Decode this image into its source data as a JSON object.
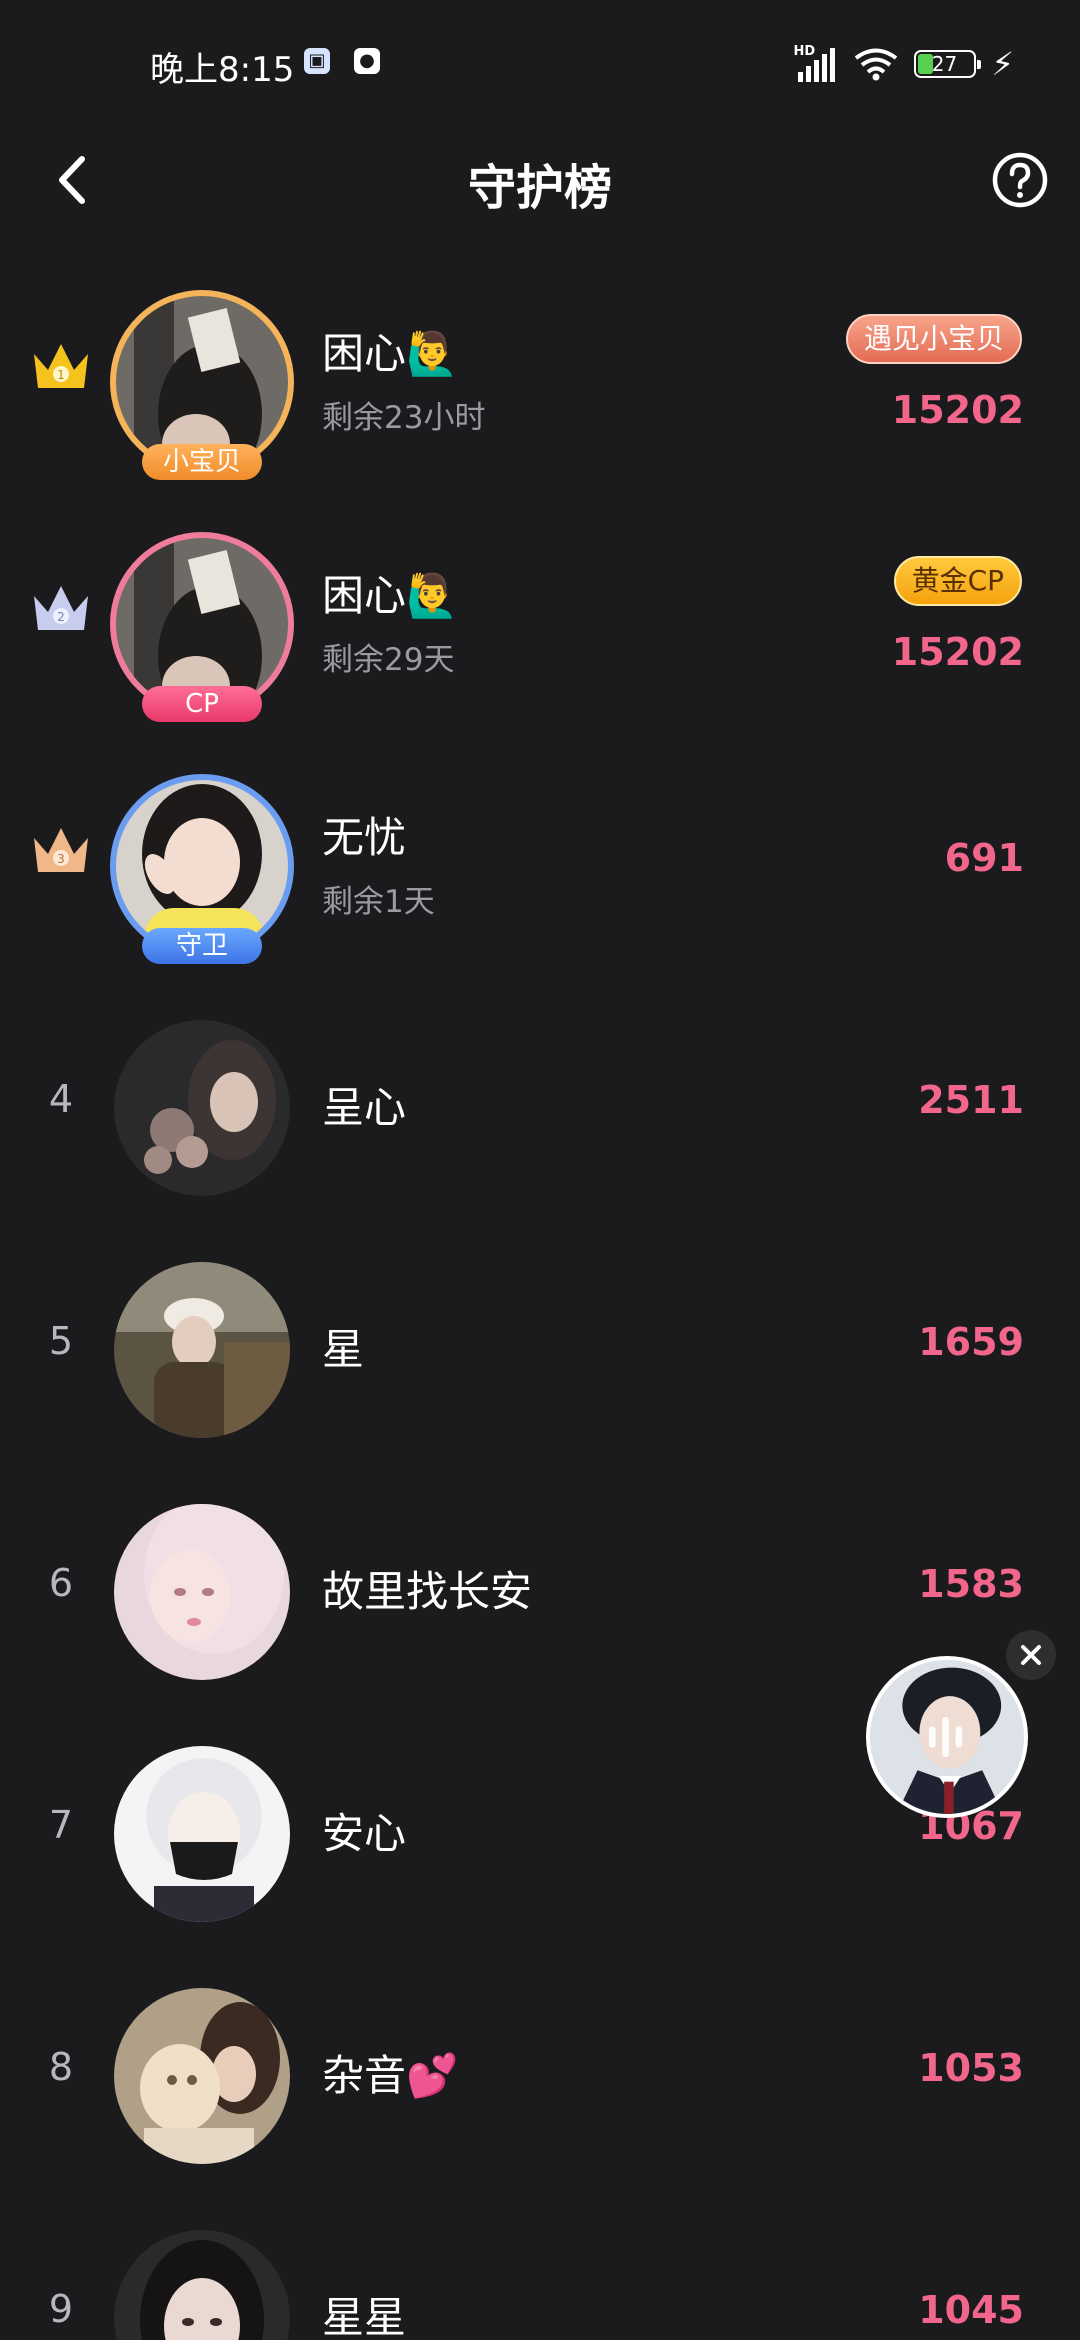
{
  "status_bar": {
    "time": "晚上8:15",
    "network_label": "HD",
    "battery_level": "27"
  },
  "header": {
    "title": "守护榜"
  },
  "ranking": [
    {
      "rank": "1",
      "name": "困心🙋‍♂️",
      "sub": "剩余23小时",
      "score": "15202",
      "badge": "遇见小宝贝",
      "avatar_tag": "小宝贝"
    },
    {
      "rank": "2",
      "name": "困心🙋‍♂️",
      "sub": "剩余29天",
      "score": "15202",
      "badge": "黄金CP",
      "avatar_tag": "CP"
    },
    {
      "rank": "3",
      "name": "无忧",
      "sub": "剩余1天",
      "score": "691",
      "avatar_tag": "守卫"
    },
    {
      "rank": "4",
      "name": "呈心",
      "score": "2511"
    },
    {
      "rank": "5",
      "name": "星",
      "score": "1659"
    },
    {
      "rank": "6",
      "name": "故里找长安",
      "score": "1583"
    },
    {
      "rank": "7",
      "name": "安心",
      "score": "1067"
    },
    {
      "rank": "8",
      "name": "杂音💕",
      "score": "1053"
    },
    {
      "rank": "9",
      "name": "星星",
      "score": "1045"
    }
  ],
  "colors": {
    "background": "#1b1b1d",
    "score": "#f2668b",
    "gold": "#f5b830",
    "silver": "#c8cdf0",
    "bronze": "#f0b888"
  }
}
